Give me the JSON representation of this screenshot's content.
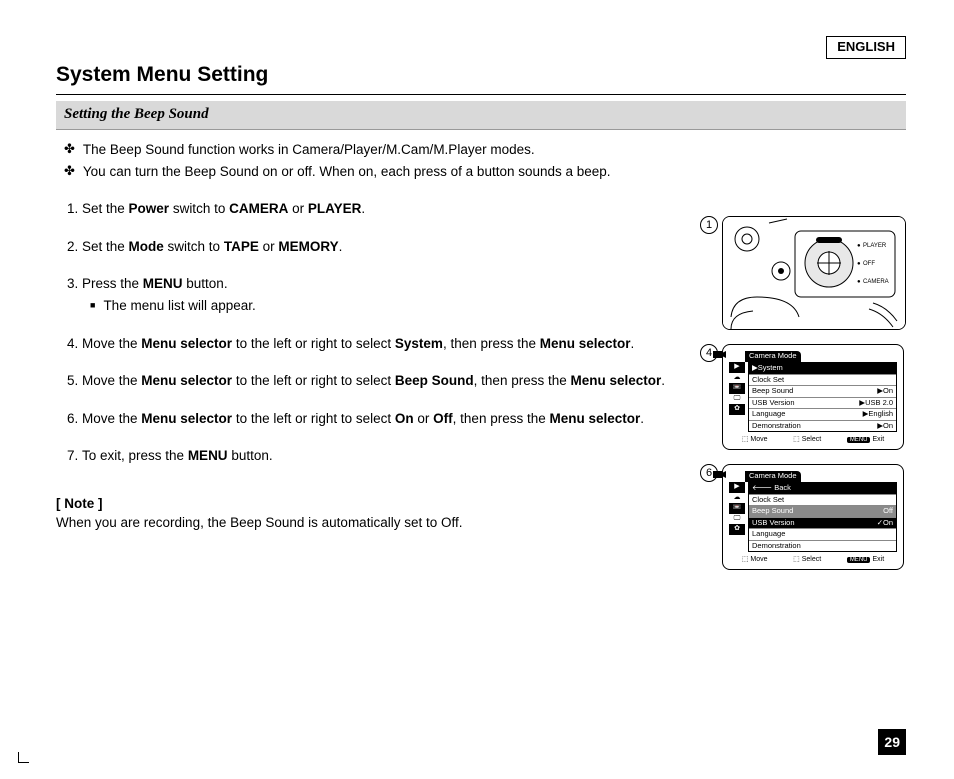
{
  "language_tag": "ENGLISH",
  "title": "System Menu Setting",
  "subhead": "Setting the Beep Sound",
  "intro": [
    "The Beep Sound function works in Camera/Player/M.Cam/M.Player modes.",
    "You can turn the Beep Sound on or off. When on, each press of a button sounds a beep."
  ],
  "steps": [
    {
      "pre": "Set the ",
      "b1": "Power",
      "mid1": " switch to ",
      "b2": "CAMERA",
      "mid2": " or ",
      "b3": "PLAYER",
      "post": "."
    },
    {
      "pre": "Set the ",
      "b1": "Mode",
      "mid1": " switch to ",
      "b2": "TAPE",
      "mid2": " or ",
      "b3": "MEMORY",
      "post": "."
    },
    {
      "pre": "Press the ",
      "b1": "MENU",
      "mid1": " button.",
      "sub": "The menu list will appear."
    },
    {
      "pre": "Move the ",
      "b1": "Menu selector",
      "mid1": " to the left or right to select ",
      "b2": "System",
      "mid2": ", then press the ",
      "b3": "Menu selector",
      "post": "."
    },
    {
      "pre": "Move the ",
      "b1": "Menu selector",
      "mid1": " to the left or right to select ",
      "b2": "Beep Sound",
      "mid2": ", then press the ",
      "b3": "Menu selector",
      "post": "."
    },
    {
      "pre": "Move the ",
      "b1": "Menu selector",
      "mid1": " to the left or right to select ",
      "b2": "On",
      "mid2": " or ",
      "b3": "Off",
      "mid3": ", then press the ",
      "b4": "Menu selector",
      "post": "."
    },
    {
      "pre": "To exit, press the ",
      "b1": "MENU",
      "mid1": " button."
    }
  ],
  "note_head": "[ Note ]",
  "note_text": "When you are recording, the Beep Sound is automatically set to Off.",
  "dial": {
    "labels": [
      "PLAYER",
      "OFF",
      "CAMERA"
    ]
  },
  "menus": {
    "m4": {
      "num": "4",
      "mode": "Camera Mode",
      "rows": [
        {
          "label": "▶System",
          "val": "",
          "dark": true
        },
        {
          "label": "Clock Set",
          "val": ""
        },
        {
          "label": "Beep Sound",
          "val": "▶On"
        },
        {
          "label": "USB Version",
          "val": "▶USB 2.0"
        },
        {
          "label": "Language",
          "val": "▶English"
        },
        {
          "label": "Demonstration",
          "val": "▶On"
        }
      ],
      "foot": {
        "move": "Move",
        "select": "Select",
        "menu_chip": "MENU",
        "exit": "Exit"
      }
    },
    "m6": {
      "num": "6",
      "mode": "Camera Mode",
      "rows": [
        {
          "label": "🡐 Back",
          "val": "",
          "dark": true
        },
        {
          "label": "Clock Set",
          "val": ""
        },
        {
          "label": "Beep Sound",
          "val": "Off",
          "gray": true
        },
        {
          "label": "USB Version",
          "val": "✓On",
          "dark": true
        },
        {
          "label": "Language",
          "val": ""
        },
        {
          "label": "Demonstration",
          "val": ""
        }
      ],
      "foot": {
        "move": "Move",
        "select": "Select",
        "menu_chip": "MENU",
        "exit": "Exit"
      }
    }
  },
  "page_number": "29",
  "callout_1": "1"
}
